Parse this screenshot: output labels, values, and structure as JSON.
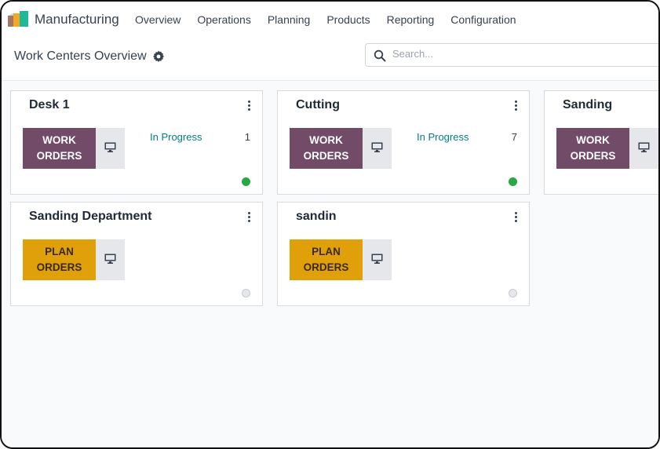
{
  "app": {
    "name": "Manufacturing"
  },
  "menu": [
    "Overview",
    "Operations",
    "Planning",
    "Products",
    "Reporting",
    "Configuration"
  ],
  "page": {
    "title": "Work Centers Overview"
  },
  "search": {
    "placeholder": "Search..."
  },
  "colors": {
    "work_orders": "#714b67",
    "plan_orders": "#e0a00a",
    "in_progress": "#017e84",
    "online": "#28a745"
  },
  "cards": [
    {
      "title": "Desk 1",
      "button_line1": "WORK",
      "button_line2": "ORDERS",
      "status_label": "In Progress",
      "status_count": "1",
      "online": true
    },
    {
      "title": "Cutting",
      "button_line1": "WORK",
      "button_line2": "ORDERS",
      "status_label": "In Progress",
      "status_count": "7",
      "online": true
    },
    {
      "title": "Sanding",
      "button_line1": "WORK",
      "button_line2": "ORDERS",
      "status_label": "",
      "status_count": "",
      "online": true
    },
    {
      "title": "Sanding Department",
      "button_line1": "PLAN",
      "button_line2": "ORDERS",
      "status_label": "",
      "status_count": "",
      "online": false
    },
    {
      "title": "sandin",
      "button_line1": "PLAN",
      "button_line2": "ORDERS",
      "status_label": "",
      "status_count": "",
      "online": false
    }
  ]
}
